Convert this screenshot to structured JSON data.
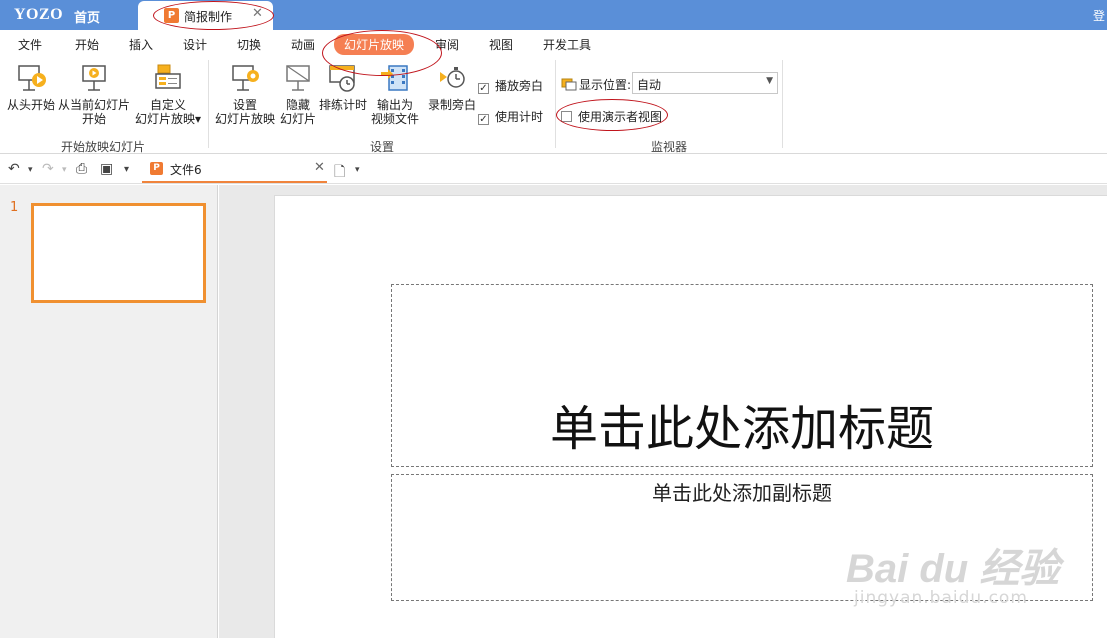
{
  "titlebar": {
    "logo": "YOZO",
    "home_tab": "首页",
    "doc_tab": {
      "icon": "P",
      "label": "简报制作",
      "close": "✕"
    },
    "right_text": "登"
  },
  "menu": {
    "tabs": [
      "文件",
      "开始",
      "插入",
      "设计",
      "切换",
      "动画",
      "幻灯片放映",
      "审阅",
      "视图",
      "开发工具"
    ],
    "active": "幻灯片放映"
  },
  "ribbon": {
    "start_group": {
      "label": "开始放映幻灯片",
      "from_start": "从头开始",
      "from_current_line1": "从当前幻灯片",
      "from_current_line2": "开始",
      "custom_line1": "自定义",
      "custom_line2": "幻灯片放映"
    },
    "setup_group": {
      "label": "设置",
      "setup_line1": "设置",
      "setup_line2": "幻灯片放映",
      "hide_line1": "隐藏",
      "hide_line2": "幻灯片",
      "rehearse": "排练计时",
      "export_line1": "输出为",
      "export_line2": "视频文件",
      "record_narration": "录制旁白",
      "play_narration": "播放旁白",
      "use_timing": "使用计时"
    },
    "monitor_group": {
      "label": "监视器",
      "display_position_label": "显示位置:",
      "display_position_value": "自动",
      "presenter_view": "使用演示者视图"
    }
  },
  "quickbar": {
    "file_tab": {
      "icon": "P",
      "label": "文件6",
      "close": "✕"
    }
  },
  "slides": {
    "current_number": "1",
    "title_placeholder": "单击此处添加标题",
    "subtitle_placeholder": "单击此处添加副标题"
  },
  "watermark": {
    "line1": "Bai du 经验",
    "line2": "jingyan.baidu.com"
  },
  "colors": {
    "titlebar": "#5a8fd8",
    "active_tab": "#f57f53",
    "accent_orange": "#f09030",
    "annotation_red": "#c0141c"
  }
}
